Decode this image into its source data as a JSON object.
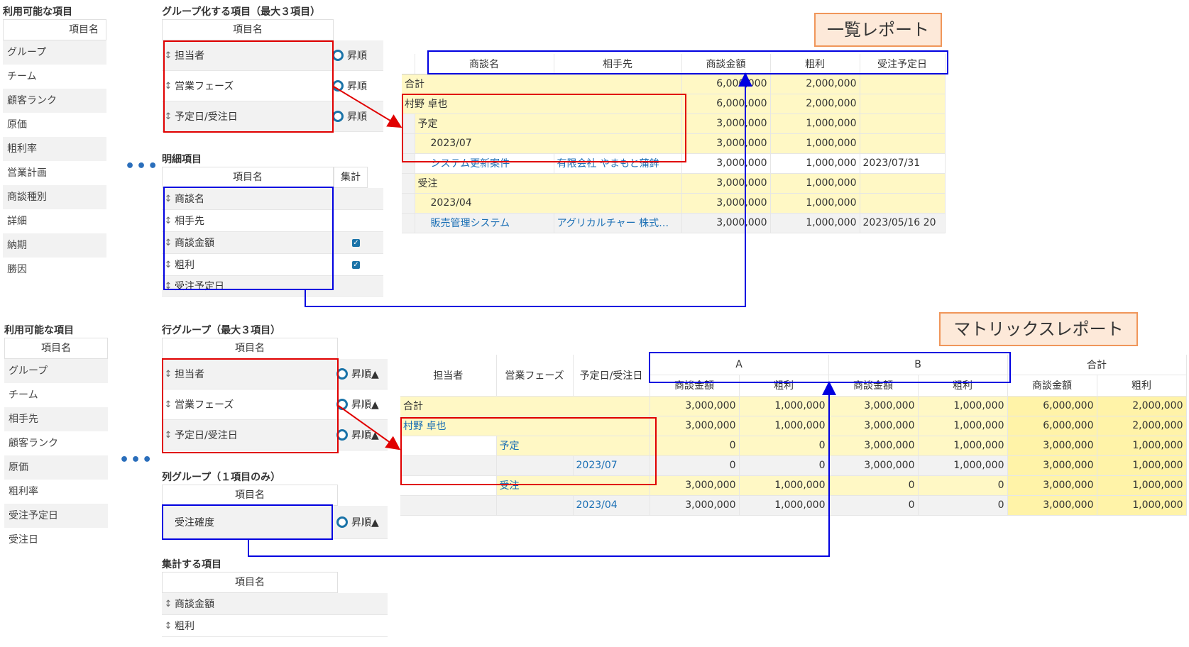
{
  "top": {
    "available": {
      "title": "利用可能な項目",
      "header": "項目名",
      "items": [
        "グループ",
        "チーム",
        "顧客ランク",
        "原価",
        "粗利率",
        "営業計画",
        "商談種別",
        "詳細",
        "納期",
        "勝因"
      ]
    },
    "grouping": {
      "title": "グループ化する項目（最大３項目）",
      "header": "項目名",
      "items": [
        "担当者",
        "営業フェーズ",
        "予定日/受注日"
      ],
      "sort_label": "昇順"
    },
    "detail": {
      "title": "明細項目",
      "header": "項目名",
      "agg_header": "集計",
      "items": [
        "商談名",
        "相手先",
        "商談金額",
        "粗利",
        "受注予定日"
      ]
    },
    "dots": "•••"
  },
  "list_report": {
    "label": "一覧レポート",
    "columns": [
      "商談名",
      "相手先",
      "商談金額",
      "粗利",
      "受注予定日"
    ],
    "rows": [
      {
        "c0": "合計",
        "c1": "",
        "amount": "6,000,000",
        "profit": "2,000,000",
        "date": ""
      },
      {
        "c0": "村野 卓也",
        "c1": "",
        "amount": "6,000,000",
        "profit": "2,000,000",
        "date": ""
      },
      {
        "c0": "予定",
        "c1": "",
        "amount": "3,000,000",
        "profit": "1,000,000",
        "date": ""
      },
      {
        "c0": "2023/07",
        "c1": "",
        "amount": "3,000,000",
        "profit": "1,000,000",
        "date": ""
      },
      {
        "c0": "システム更新案件",
        "c1": "有限会社 やまもと蒲鉾",
        "amount": "3,000,000",
        "profit": "1,000,000",
        "date": "2023/07/31"
      },
      {
        "c0": "受注",
        "c1": "",
        "amount": "3,000,000",
        "profit": "1,000,000",
        "date": ""
      },
      {
        "c0": "2023/04",
        "c1": "",
        "amount": "3,000,000",
        "profit": "1,000,000",
        "date": ""
      },
      {
        "c0": "販売管理システム",
        "c1": "アグリカルチャー 株式…",
        "amount": "3,000,000",
        "profit": "1,000,000",
        "date": "2023/05/16",
        "extra": "20"
      }
    ]
  },
  "bottom": {
    "available": {
      "title": "利用可能な項目",
      "header": "項目名",
      "items": [
        "グループ",
        "チーム",
        "相手先",
        "顧客ランク",
        "原価",
        "粗利率",
        "受注予定日",
        "受注日"
      ]
    },
    "row_group": {
      "title": "行グループ（最大３項目）",
      "header": "項目名",
      "items": [
        "担当者",
        "営業フェーズ",
        "予定日/受注日"
      ],
      "sort_label": "昇順▲"
    },
    "col_group": {
      "title": "列グループ（１項目のみ）",
      "header": "項目名",
      "items": [
        "受注確度"
      ],
      "sort_label": "昇順▲"
    },
    "agg": {
      "title": "集計する項目",
      "header": "項目名",
      "items": [
        "商談金額",
        "粗利"
      ]
    },
    "dots": "•••"
  },
  "matrix_report": {
    "label": "マトリックスレポート",
    "row_headers": [
      "担当者",
      "営業フェーズ",
      "予定日/受注日"
    ],
    "col_groups": [
      "A",
      "B",
      "合計"
    ],
    "sub_headers": [
      "商談金額",
      "粗利"
    ],
    "rows": [
      {
        "l0": "合計",
        "l1": "",
        "l2": "",
        "v": [
          "3,000,000",
          "1,000,000",
          "3,000,000",
          "1,000,000",
          "6,000,000",
          "2,000,000"
        ]
      },
      {
        "l0": "村野 卓也",
        "l1": "",
        "l2": "",
        "v": [
          "3,000,000",
          "1,000,000",
          "3,000,000",
          "1,000,000",
          "6,000,000",
          "2,000,000"
        ]
      },
      {
        "l0": "",
        "l1": "予定",
        "l2": "",
        "v": [
          "0",
          "0",
          "3,000,000",
          "1,000,000",
          "3,000,000",
          "1,000,000"
        ]
      },
      {
        "l0": "",
        "l1": "",
        "l2": "2023/07",
        "v": [
          "0",
          "0",
          "3,000,000",
          "1,000,000",
          "3,000,000",
          "1,000,000"
        ]
      },
      {
        "l0": "",
        "l1": "受注",
        "l2": "",
        "v": [
          "3,000,000",
          "1,000,000",
          "0",
          "0",
          "3,000,000",
          "1,000,000"
        ]
      },
      {
        "l0": "",
        "l1": "",
        "l2": "2023/04",
        "v": [
          "3,000,000",
          "1,000,000",
          "0",
          "0",
          "3,000,000",
          "1,000,000"
        ]
      }
    ]
  },
  "colors": {
    "highlight_red": "#e00000",
    "highlight_blue": "#0000e0",
    "total_row": "#fff8c5",
    "link": "#1a6fb5",
    "tag_fill": "#fde9d9",
    "tag_border": "#f0965a"
  }
}
